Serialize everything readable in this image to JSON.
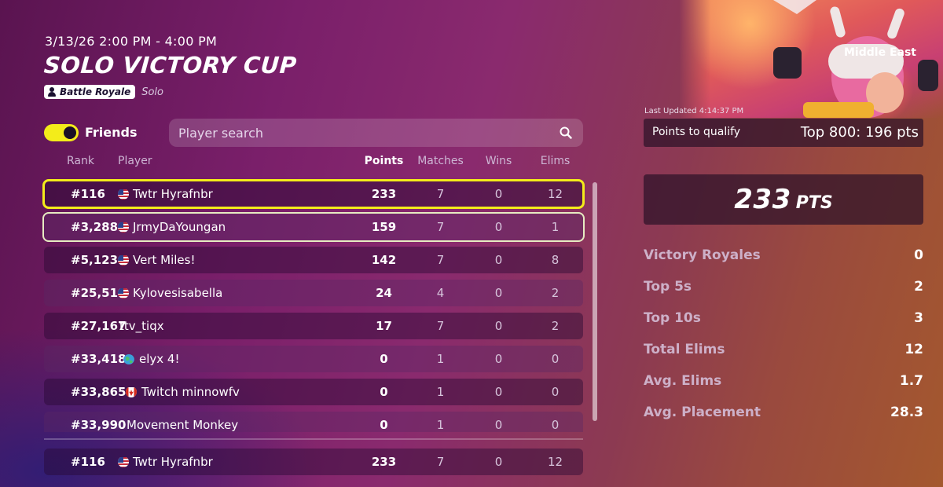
{
  "event": {
    "datetime": "3/13/26 2:00 PM - 4:00 PM",
    "title": "SOLO VICTORY CUP",
    "mode": "Battle Royale",
    "submode": "Solo"
  },
  "filters": {
    "friends_label": "Friends",
    "friends_on": true,
    "search_placeholder": "Player search"
  },
  "columns": {
    "rank": "Rank",
    "player": "Player",
    "points": "Points",
    "matches": "Matches",
    "wins": "Wins",
    "elims": "Elims"
  },
  "rows": [
    {
      "rank": "#116",
      "flag": "us",
      "player": "Twtr Hyrafnbr",
      "points": "233",
      "matches": "7",
      "wins": "0",
      "elims": "12"
    },
    {
      "rank": "#3,288",
      "flag": "us",
      "player": "JrmyDaYoungan",
      "points": "159",
      "matches": "7",
      "wins": "0",
      "elims": "1"
    },
    {
      "rank": "#5,123",
      "flag": "us",
      "player": "Vert Miles!",
      "points": "142",
      "matches": "7",
      "wins": "0",
      "elims": "8"
    },
    {
      "rank": "#25,519",
      "flag": "us",
      "player": "Kylovesisabella",
      "points": "24",
      "matches": "4",
      "wins": "0",
      "elims": "2"
    },
    {
      "rank": "#27,167",
      "flag": "",
      "player": "ttv_tiqx",
      "points": "17",
      "matches": "7",
      "wins": "0",
      "elims": "2"
    },
    {
      "rank": "#33,418",
      "flag": "globe",
      "player": "elyx 4!",
      "points": "0",
      "matches": "1",
      "wins": "0",
      "elims": "0"
    },
    {
      "rank": "#33,865",
      "flag": "ca",
      "player": "Twitch minnowfv",
      "points": "0",
      "matches": "1",
      "wins": "0",
      "elims": "0"
    },
    {
      "rank": "#33,990",
      "flag": "",
      "player": "Movement Monkey",
      "points": "0",
      "matches": "1",
      "wins": "0",
      "elims": "0"
    }
  ],
  "pinned_row": {
    "rank": "#116",
    "flag": "us",
    "player": "Twtr Hyrafnbr",
    "points": "233",
    "matches": "7",
    "wins": "0",
    "elims": "12"
  },
  "panel": {
    "region": "Middle East",
    "last_updated": "Last Updated 4:14:37 PM",
    "qualify_label": "Points to qualify",
    "qualify_value": "Top 800: 196 pts",
    "total_points": "233",
    "points_unit": "PTS",
    "stats": [
      {
        "label": "Victory Royales",
        "value": "0"
      },
      {
        "label": "Top 5s",
        "value": "2"
      },
      {
        "label": "Top 10s",
        "value": "3"
      },
      {
        "label": "Total Elims",
        "value": "12"
      },
      {
        "label": "Avg. Elims",
        "value": "1.7"
      },
      {
        "label": "Avg. Placement",
        "value": "28.3"
      }
    ]
  },
  "colors": {
    "accent_yellow": "#f3ec1a",
    "highlight_white": "#e7ecc2"
  }
}
